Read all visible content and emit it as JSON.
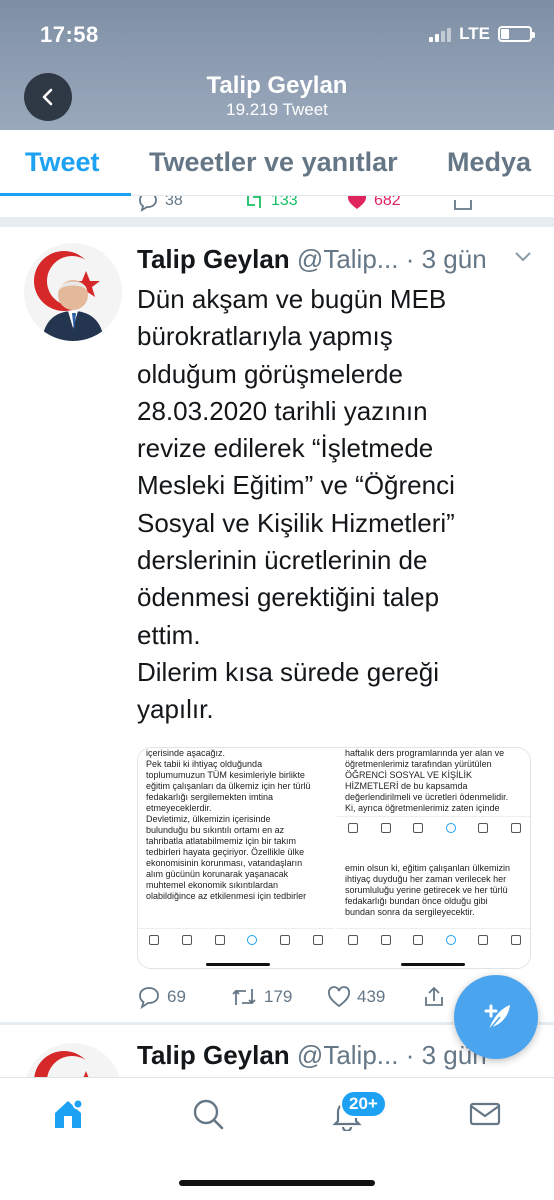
{
  "status_bar": {
    "time": "17:58",
    "network": "LTE"
  },
  "header": {
    "title": "Talip Geylan",
    "subtitle": "19.219 Tweet",
    "back_icon": "chevron-left-icon"
  },
  "tabs": [
    {
      "label": "Tweet",
      "active": true
    },
    {
      "label": "Tweetler ve yanıtlar",
      "active": false
    },
    {
      "label": "Medya",
      "active": false
    }
  ],
  "previous_tweet_actions": {
    "replies": "38",
    "retweets": "133",
    "likes": "682"
  },
  "tweet": {
    "name": "Talip Geylan",
    "handle": "@Talip...",
    "time": "· 3 gün",
    "text": "Dün akşam ve bugün MEB\nbürokratlarıyla yapmış\nolduğum görüşmelerde\n28.03.2020 tarihli yazının\nrevize edilerek “İşletmede\nMesleki Eğitim” ve “Öğrenci\nSosyal ve Kişilik Hizmetleri”\nderslerinin ücretlerinin de\nödenmesi gerektiğini talep\nettim.\nDilerim kısa sürede gereği\nyapılır.",
    "media": {
      "left_text": "içerisinde aşacağız.\nPek tabii ki ihtiyaç olduğunda\ntoplumumuzun TÜM kesimleriyle birlikte\neğitim çalışanları da ülkemiz için her türlü\nfedakarlığı sergilemekten imtina\netmeyeceklerdir.\nDevletimiz, ülkemizin içerisinde\nbulunduğu bu sıkıntılı ortamı en az\ntahribatla atlatabilmemiz için bir takım\ntedbirleri hayata geçiriyor. Özellikle ülke\nekonomisinin korunması, vatandaşların\nalım gücünün korunarak yaşanacak\nmuhtemel ekonomik sıkıntılardan\nolabildiğince az etkilenmesi için tedbirler",
      "right_top_text": "haftalık ders programlarında yer alan ve\nöğretmenlerimiz tarafından yürütülen\nÖĞRENCİ SOSYAL VE KİŞİLİK\nHİZMETLERİ de bu kapsamda\ndeğerlendirilmeli ve ücretleri ödenmelidir.\nKi, ayrıca öğretmenlerimiz zaten içinde",
      "right_bottom_text": "emin olsun ki, eğitim çalışanları ülkemizin\nihtiyaç duyduğu her zaman verilecek her\nsorumluluğu yerine getirecek ve her türlü\nfedakarlığı bundan önce olduğu gibi\nbundan sonra da sergileyecektir."
    },
    "replies": "69",
    "retweets": "179",
    "likes": "439"
  },
  "next_tweet": {
    "name": "Talip Geylan",
    "handle": "@Talip...",
    "time": "· 3 gün"
  },
  "bottom_nav": {
    "notifications_badge": "20+"
  },
  "colors": {
    "accent": "#1da1f2",
    "retweet": "#17bf63",
    "like": "#e0245e"
  }
}
